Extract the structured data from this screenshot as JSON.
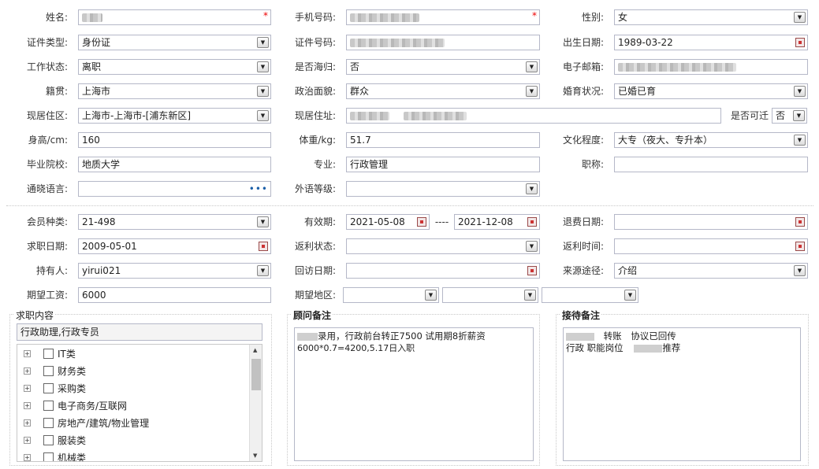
{
  "basic": {
    "name_label": "姓名:",
    "phone_label": "手机号码:",
    "gender_label": "性别:",
    "gender_value": "女",
    "id_type_label": "证件类型:",
    "id_type_value": "身份证",
    "id_no_label": "证件号码:",
    "birth_label": "出生日期:",
    "birth_value": "1989-03-22",
    "work_status_label": "工作状态:",
    "work_status_value": "离职",
    "returnee_label": "是否海归:",
    "returnee_value": "否",
    "email_label": "电子邮箱:",
    "native_label": "籍贯:",
    "native_value": "上海市",
    "political_label": "政治面貌:",
    "political_value": "群众",
    "marital_label": "婚育状况:",
    "marital_value": "已婚已育",
    "residence_area_label": "现居住区:",
    "residence_area_value": "上海市-上海市-[浦东新区]",
    "address_label": "现居住址:",
    "relocate_label": "是否可迁",
    "relocate_value": "否",
    "height_label": "身高/cm:",
    "height_value": "160",
    "weight_label": "体重/kg:",
    "weight_value": "51.7",
    "education_label": "文化程度:",
    "education_value": "大专（夜大、专升本）",
    "school_label": "毕业院校:",
    "school_value": "地质大学",
    "major_label": "专业:",
    "major_value": "行政管理",
    "title_label": "职称:",
    "title_value": "",
    "language_label": "通晓语言:",
    "language_more": "•••",
    "foreign_level_label": "外语等级:"
  },
  "member": {
    "type_label": "会员种类:",
    "type_value": "21-498",
    "valid_label": "有效期:",
    "valid_from": "2021-05-08",
    "valid_sep": "----",
    "valid_to": "2021-12-08",
    "refund_date_label": "退费日期:",
    "job_date_label": "求职日期:",
    "job_date_value": "2009-05-01",
    "rebate_status_label": "返利状态:",
    "rebate_time_label": "返利时间:",
    "holder_label": "持有人:",
    "holder_value": "yirui021",
    "revisit_label": "回访日期:",
    "source_label": "来源途径:",
    "source_value": "介绍",
    "salary_label": "期望工资:",
    "salary_value": "6000",
    "region_label": "期望地区:"
  },
  "job_content": {
    "legend": "求职内容",
    "selected": "行政助理,行政专员",
    "tree": [
      {
        "label": "IT类"
      },
      {
        "label": "财务类"
      },
      {
        "label": "采购类"
      },
      {
        "label": "电子商务/互联网"
      },
      {
        "label": "房地产/建筑/物业管理"
      },
      {
        "label": "服装类"
      },
      {
        "label": "机械类"
      }
    ]
  },
  "consultant_note": {
    "legend": "顾问备注",
    "line1_text": "录用，行政前台转正7500 试用期8折薪资",
    "line2_text": "6000*0.7=4200,5.17日入职"
  },
  "reception_note": {
    "legend": "接待备注",
    "line1_a": "转账",
    "line1_b": "协议已回传",
    "line2_a": "行政 职能岗位",
    "line2_b": "推荐"
  },
  "icons": {
    "dropdown": "chevron-down-icon",
    "calendar": "calendar-icon",
    "expand": "plus-icon"
  },
  "colors": {
    "border": "#b5b8c8",
    "required": "#e00000",
    "more": "#1a5ea8"
  }
}
